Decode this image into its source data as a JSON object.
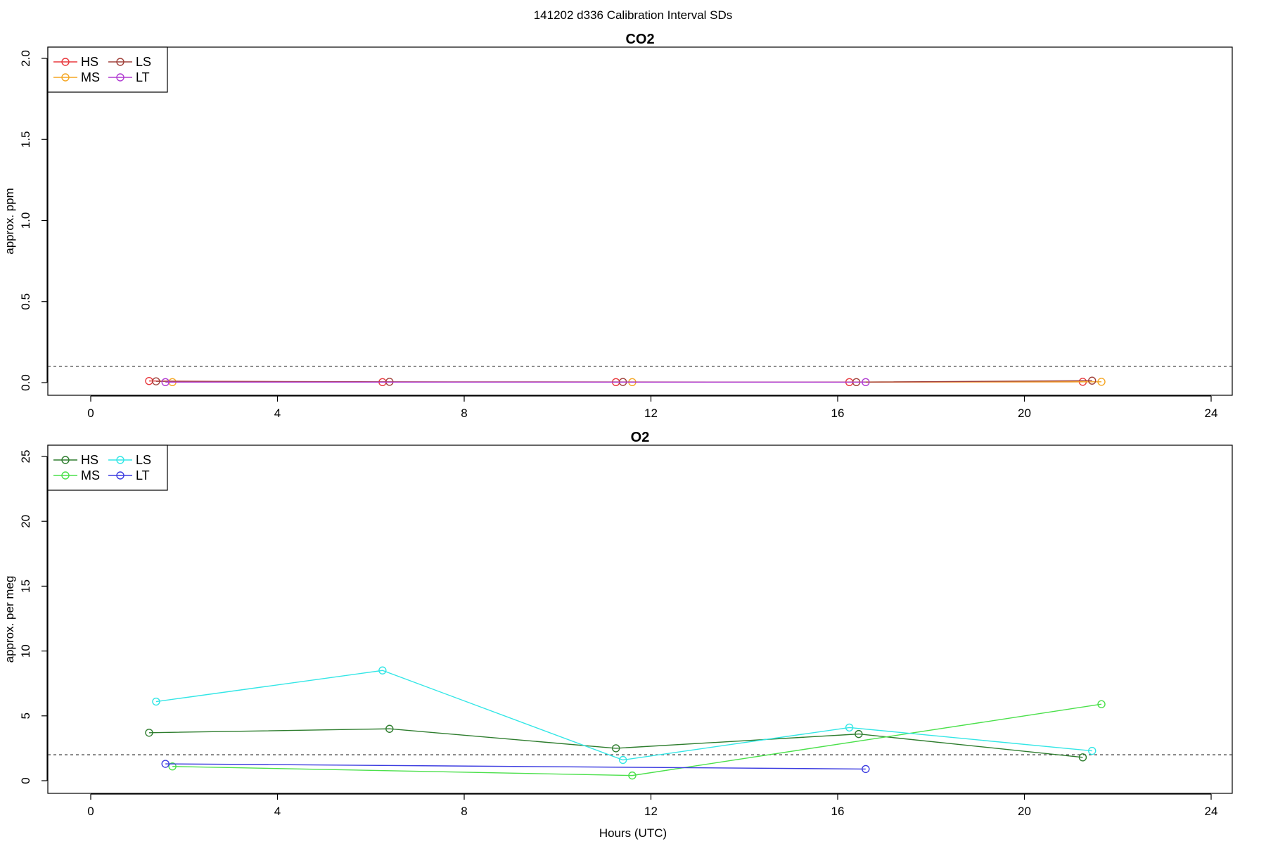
{
  "figure": {
    "title": "141202   d336   Calibration Interval SDs",
    "xlabel": "Hours (UTC)"
  },
  "chart_data": [
    {
      "type": "line",
      "title": "CO2",
      "xlabel": "",
      "ylabel": "approx. ppm",
      "xlim": [
        0,
        24
      ],
      "ylim": [
        0,
        2.0
      ],
      "xticks": [
        "0",
        "4",
        "8",
        "12",
        "16",
        "20",
        "24"
      ],
      "yticks": [
        "0.0",
        "0.5",
        "1.0",
        "1.5",
        "2.0"
      ],
      "reference_line": 0.1,
      "grid": false,
      "legend": "top-left",
      "series": [
        {
          "name": "HS",
          "color": "#e8383d",
          "x": [
            1.25,
            6.25,
            11.25,
            16.25,
            21.25
          ],
          "y": [
            0.01,
            0.003,
            0.003,
            0.003,
            0.005
          ]
        },
        {
          "name": "MS",
          "color": "#f5a623",
          "x": [
            1.75,
            11.6,
            21.65
          ],
          "y": [
            0.003,
            0.003,
            0.005
          ]
        },
        {
          "name": "LS",
          "color": "#a0403a",
          "x": [
            1.4,
            6.4,
            11.4,
            16.4,
            21.45
          ],
          "y": [
            0.008,
            0.005,
            0.004,
            0.003,
            0.012
          ]
        },
        {
          "name": "LT",
          "color": "#b03bd1",
          "x": [
            1.6,
            16.6
          ],
          "y": [
            0.003,
            0.003
          ]
        }
      ]
    },
    {
      "type": "line",
      "title": "O2",
      "xlabel": "Hours (UTC)",
      "ylabel": "approx. per meg",
      "xlim": [
        0,
        24
      ],
      "ylim": [
        0,
        25
      ],
      "xticks": [
        "0",
        "4",
        "8",
        "12",
        "16",
        "20",
        "24"
      ],
      "yticks": [
        "0",
        "5",
        "10",
        "15",
        "20",
        "25"
      ],
      "reference_line": 2,
      "grid": false,
      "legend": "top-left",
      "series": [
        {
          "name": "HS",
          "color": "#2e7d2e",
          "x": [
            1.25,
            6.4,
            11.25,
            16.45,
            21.25
          ],
          "y": [
            3.7,
            4.0,
            2.5,
            3.6,
            1.8
          ]
        },
        {
          "name": "MS",
          "color": "#4be04b",
          "x": [
            1.75,
            11.6,
            21.65
          ],
          "y": [
            1.1,
            0.4,
            5.9
          ]
        },
        {
          "name": "LS",
          "color": "#33e6e6",
          "x": [
            1.4,
            6.25,
            11.4,
            16.25,
            21.45
          ],
          "y": [
            6.1,
            8.5,
            1.6,
            4.1,
            2.3
          ]
        },
        {
          "name": "LT",
          "color": "#3c3ce0",
          "x": [
            1.6,
            16.6
          ],
          "y": [
            1.3,
            0.9
          ]
        }
      ]
    }
  ]
}
